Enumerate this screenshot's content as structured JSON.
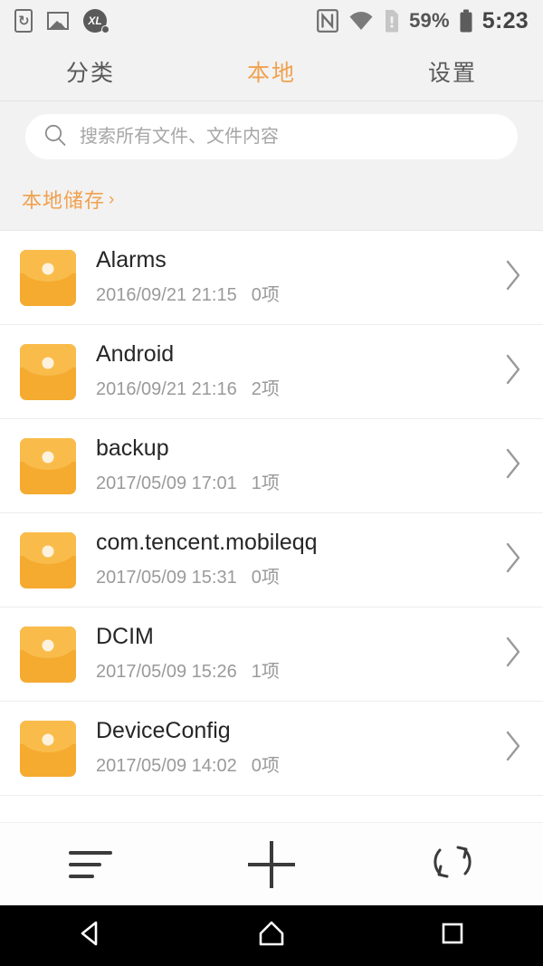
{
  "status_bar": {
    "left_icons": [
      {
        "name": "rotation-lock-icon",
        "glyph": "↻"
      },
      {
        "name": "screenshot-photo-icon",
        "glyph": "Ὓb"
      },
      {
        "name": "xl-search-icon",
        "label": "XL"
      }
    ],
    "nfc_label": "N",
    "battery_percent": "59%",
    "clock": "5:23"
  },
  "tabs": [
    {
      "label": "分类",
      "active": false
    },
    {
      "label": "本地",
      "active": true
    },
    {
      "label": "设置",
      "active": false
    }
  ],
  "search": {
    "placeholder": "搜索所有文件、文件内容",
    "value": ""
  },
  "breadcrumb": {
    "label": "本地储存",
    "arrow": "›"
  },
  "files": [
    {
      "name": "Alarms",
      "date": "2016/09/21 21:15",
      "count": "0项"
    },
    {
      "name": "Android",
      "date": "2016/09/21 21:16",
      "count": "2项"
    },
    {
      "name": "backup",
      "date": "2017/05/09 17:01",
      "count": "1项"
    },
    {
      "name": "com.tencent.mobileqq",
      "date": "2017/05/09 15:31",
      "count": "0项"
    },
    {
      "name": "DCIM",
      "date": "2017/05/09 15:26",
      "count": "1项"
    },
    {
      "name": "DeviceConfig",
      "date": "2017/05/09 14:02",
      "count": "0项"
    }
  ],
  "toolbar": [
    {
      "name": "sort-button",
      "icon": "sort-lines-icon"
    },
    {
      "name": "add-button",
      "icon": "plus-icon"
    },
    {
      "name": "refresh-button",
      "icon": "refresh-icon"
    }
  ],
  "navigation": [
    {
      "name": "back-button",
      "icon": "triangle-back-icon"
    },
    {
      "name": "home-button",
      "icon": "home-pentagon-icon"
    },
    {
      "name": "recents-button",
      "icon": "square-recents-icon"
    }
  ],
  "colors": {
    "accent": "#f0a14f",
    "folder": "#f5aa30",
    "folder_flap": "#f9bc4b",
    "header_bg": "#f2f2f2",
    "list_bg": "#ffffff",
    "primary_text": "#262626",
    "secondary_text": "#9a9a9a",
    "navbar_bg": "#000000"
  }
}
